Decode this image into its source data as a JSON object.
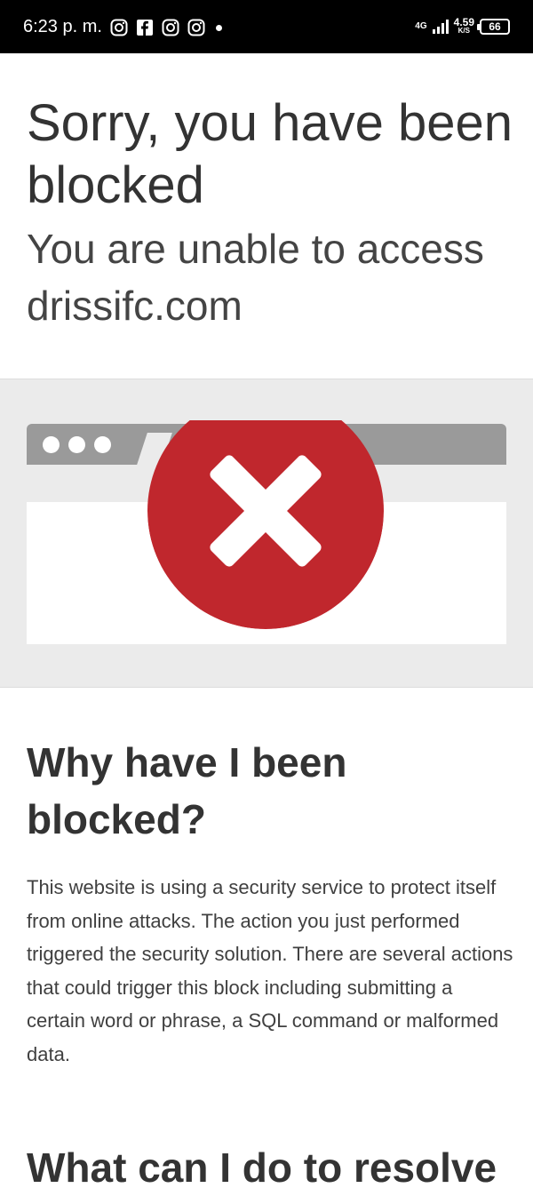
{
  "status_bar": {
    "time": "6:23 p. m.",
    "network_type": "4G",
    "speed_value": "4.59",
    "speed_unit": "K/S",
    "battery": "66",
    "notification_icons": [
      "instagram-icon",
      "facebook-icon",
      "instagram-icon",
      "instagram-icon"
    ]
  },
  "page": {
    "title": "Sorry, you have been blocked",
    "subtitle": "You are unable to access drissifc.com",
    "why_heading": "Why have I been blocked?",
    "why_body": "This website is using a security service to protect itself from online attacks. The action you just performed triggered the security solution. There are several actions that could trigger this block including submitting a certain word or phrase, a SQL command or malformed data.",
    "resolve_heading": "What can I do to resolve"
  },
  "colors": {
    "block_red": "#c0272d",
    "browser_gray": "#9a9a9a",
    "band_background": "#ebebeb"
  },
  "illustration": {
    "icon": "blocked-x-icon"
  }
}
